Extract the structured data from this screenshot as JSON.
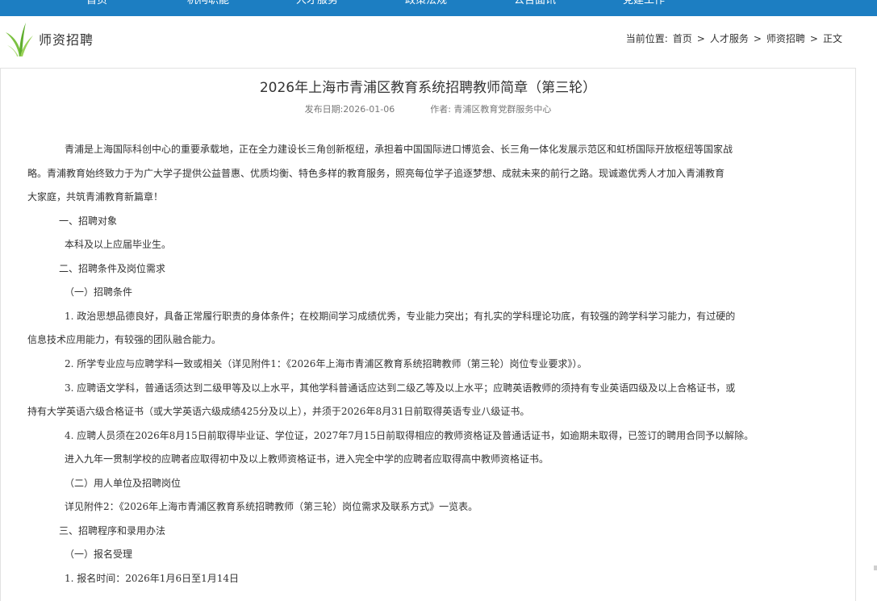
{
  "nav": {
    "items": [
      "首页",
      "机构职能",
      "人才服务",
      "政策法规",
      "公告面讯",
      "党建工作"
    ]
  },
  "section": {
    "title": "师资招聘"
  },
  "breadcrumb": {
    "prefix": "当前位置:",
    "items": [
      "首页",
      "人才服务",
      "师资招聘",
      "正文"
    ],
    "separator": ">"
  },
  "article": {
    "title": "2026年上海市青浦区教育系统招聘教师简章（第三轮）",
    "meta": {
      "date": "发布日期:2026-01-06",
      "author": "作者: 青浦区教育党群服务中心"
    },
    "lines": [
      "青浦是上海国际科创中心的重要承载地，正在全力建设长三角创新枢纽，承担着中国国际进口博览会、长三角一体化发展示范区和虹桥国际开放枢纽等国家战",
      "略。青浦教育始终致力于为广大学子提供公益普惠、优质均衡、特色多样的教育服务，照亮每位学子追逐梦想、成就未来的前行之路。现诚邀优秀人才加入青浦教育",
      "大家庭，共筑青浦教育新篇章！",
      "一、招聘对象",
      "本科及以上应届毕业生。",
      "二、招聘条件及岗位需求",
      "（一）招聘条件",
      "1. 政治思想品德良好，具备正常履行职责的身体条件；在校期间学习成绩优秀，专业能力突出；有扎实的学科理论功底，有较强的跨学科学习能力，有过硬的",
      "信息技术应用能力，有较强的团队融合能力。",
      "2. 所学专业应与应聘学科一致或相关（详见附件1：《2026年上海市青浦区教育系统招聘教师（第三轮）岗位专业要求》）。",
      "3. 应聘语文学科，普通话须达到二级甲等及以上水平，其他学科普通话应达到二级乙等及以上水平；应聘英语教师的须持有专业英语四级及以上合格证书，或",
      "持有大学英语六级合格证书（或大学英语六级成绩425分及以上），并须于2026年8月31日前取得英语专业八级证书。",
      "4. 应聘人员须在2026年8月15日前取得毕业证、学位证，2027年7月15日前取得相应的教师资格证及普通话证书，如逾期未取得，已签订的聘用合同予以解除。",
      "进入九年一贯制学校的应聘者应取得初中及以上教师资格证书，进入完全中学的应聘者应取得高中教师资格证书。",
      "（二）用人单位及招聘岗位",
      "详见附件2：《2026年上海市青浦区教育系统招聘教师（第三轮）岗位需求及联系方式》一览表。",
      "三、招聘程序和录用办法",
      "（一）报名受理",
      "1. 报名时间：2026年1月6日至1月14日"
    ]
  }
}
